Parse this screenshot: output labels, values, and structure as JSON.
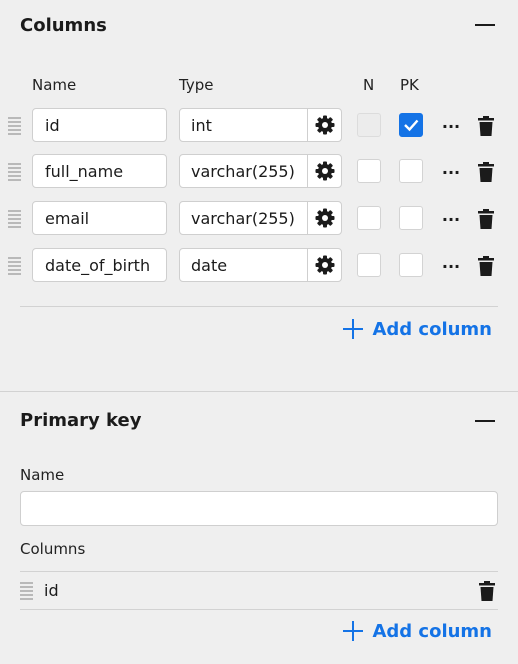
{
  "columns_section": {
    "title": "Columns",
    "headers": {
      "name": "Name",
      "type": "Type",
      "nullable": "N",
      "pk": "PK"
    },
    "rows": [
      {
        "name": "id",
        "type": "int",
        "nullable": false,
        "nullable_disabled": true,
        "pk": true
      },
      {
        "name": "full_name",
        "type": "varchar(255)",
        "nullable": false,
        "nullable_disabled": false,
        "pk": false
      },
      {
        "name": "email",
        "type": "varchar(255)",
        "nullable": false,
        "nullable_disabled": false,
        "pk": false
      },
      {
        "name": "date_of_birth",
        "type": "date",
        "nullable": false,
        "nullable_disabled": false,
        "pk": false
      }
    ],
    "more_label": "...",
    "add_column_label": "Add column"
  },
  "primary_key_section": {
    "title": "Primary key",
    "name_label": "Name",
    "name_value": "",
    "columns_label": "Columns",
    "columns": [
      {
        "name": "id"
      }
    ],
    "add_column_label": "Add column"
  },
  "colors": {
    "accent": "#1473e6",
    "background": "#efefef",
    "border": "#cfcfcf"
  }
}
